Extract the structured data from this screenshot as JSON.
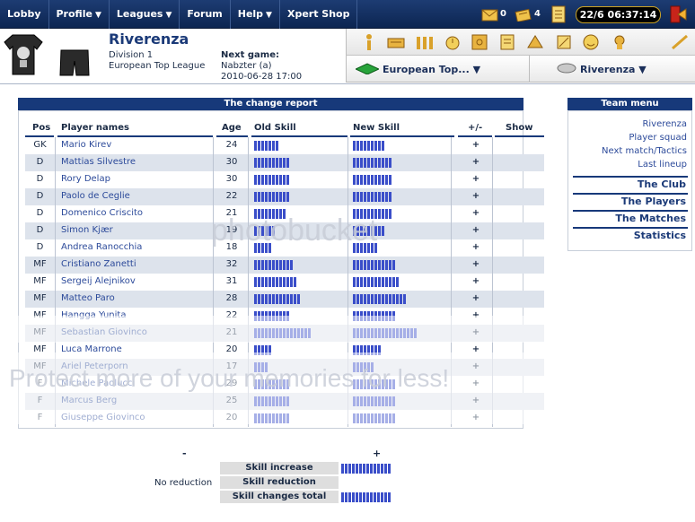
{
  "nav": {
    "items": [
      {
        "label": "Lobby",
        "caret": false
      },
      {
        "label": "Profile",
        "caret": true
      },
      {
        "label": "Leagues",
        "caret": true
      },
      {
        "label": "Forum",
        "caret": false
      },
      {
        "label": "Help",
        "caret": true
      },
      {
        "label": "Xpert Shop",
        "caret": false
      }
    ],
    "mail_count": "0",
    "messages_count": "4",
    "clock": "22/6 06:37:14"
  },
  "team": {
    "name": "Riverenza",
    "division": "Division 1",
    "league": "European Top League",
    "next_game_label": "Next game:",
    "next_opponent": "Nabzter (a)",
    "next_date": "2010-06-28 17:00",
    "league_select": "European Top...",
    "team_select": "Riverenza"
  },
  "report": {
    "title": "The change report",
    "headers": {
      "pos": "Pos",
      "name": "Player names",
      "age": "Age",
      "old": "Old Skill",
      "new": "New Skill",
      "diff": "+/-",
      "show": "Show"
    },
    "rows": [
      {
        "pos": "GK",
        "name": "Mario Kirev",
        "age": "24",
        "old": 7,
        "new": 9,
        "diff": "+"
      },
      {
        "pos": "D",
        "name": "Mattias Silvestre",
        "age": "30",
        "old": 10,
        "new": 11,
        "diff": "+"
      },
      {
        "pos": "D",
        "name": "Rory Delap",
        "age": "30",
        "old": 10,
        "new": 11,
        "diff": "+"
      },
      {
        "pos": "D",
        "name": "Paolo de Ceglie",
        "age": "22",
        "old": 10,
        "new": 11,
        "diff": "+"
      },
      {
        "pos": "D",
        "name": "Domenico Criscito",
        "age": "21",
        "old": 9,
        "new": 11,
        "diff": "+"
      },
      {
        "pos": "D",
        "name": "Simon Kjær",
        "age": "19",
        "old": 6,
        "new": 9,
        "diff": "+"
      },
      {
        "pos": "D",
        "name": "Andrea Ranocchia",
        "age": "18",
        "old": 5,
        "new": 7,
        "diff": "+"
      },
      {
        "pos": "MF",
        "name": "Cristiano Zanetti",
        "age": "32",
        "old": 11,
        "new": 12,
        "diff": "+"
      },
      {
        "pos": "MF",
        "name": "Sergeij Alejnikov",
        "age": "31",
        "old": 12,
        "new": 13,
        "diff": "+"
      },
      {
        "pos": "MF",
        "name": "Matteo Paro",
        "age": "28",
        "old": 13,
        "new": 15,
        "diff": "+"
      },
      {
        "pos": "MF",
        "name": "Hangga Yunita",
        "age": "22",
        "old": 10,
        "new": 12,
        "diff": "+"
      },
      {
        "pos": "MF",
        "name": "Sebastian Giovinco",
        "age": "21",
        "old": 16,
        "new": 18,
        "diff": "+"
      },
      {
        "pos": "MF",
        "name": "Luca Marrone",
        "age": "20",
        "old": 5,
        "new": 8,
        "diff": "+"
      },
      {
        "pos": "MF",
        "name": "Ariel Peterporn",
        "age": "17",
        "old": 4,
        "new": 6,
        "diff": "+"
      },
      {
        "pos": "F",
        "name": "Michele Paolucci",
        "age": "29",
        "old": 10,
        "new": 12,
        "diff": "+"
      },
      {
        "pos": "F",
        "name": "Marcus Berg",
        "age": "25",
        "old": 10,
        "new": 12,
        "diff": "+"
      },
      {
        "pos": "F",
        "name": "Giuseppe Giovinco",
        "age": "20",
        "old": 10,
        "new": 12,
        "diff": "+"
      }
    ],
    "summary": {
      "minus_header": "-",
      "plus_header": "+",
      "skill_increase": "Skill increase",
      "skill_reduction": "Skill reduction",
      "skill_total": "Skill changes total",
      "no_reduction": "No reduction",
      "increase_bar": 14,
      "total_bar": 14
    }
  },
  "watermark": {
    "line1": "Protect more of your memories for less!",
    "brand": "photobucket"
  },
  "menu": {
    "title": "Team menu",
    "links": [
      "Riverenza",
      "Player squad",
      "Next match/Tactics",
      "Last lineup"
    ],
    "sections": [
      "The Club",
      "The Players",
      "The Matches",
      "Statistics"
    ]
  },
  "colors": {
    "navy": "#17397a",
    "bar": "#3a4ec9",
    "row_shade": "#dde3ec"
  }
}
